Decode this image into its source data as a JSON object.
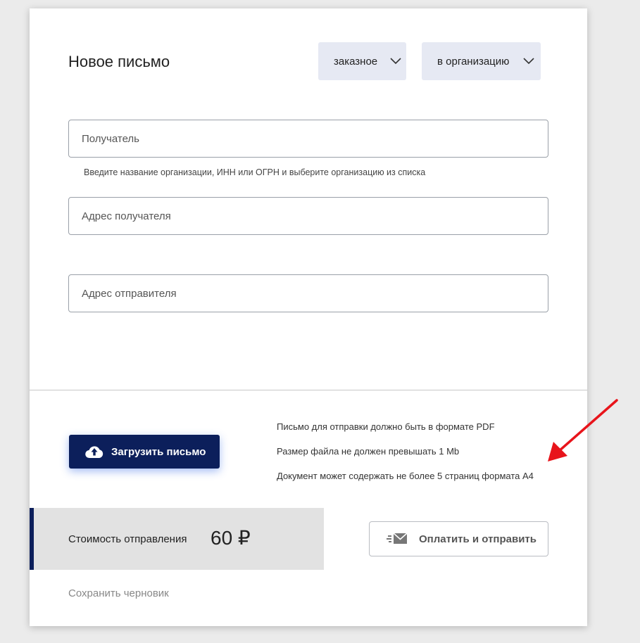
{
  "header": {
    "title": "Новое письмо",
    "type_dropdown": "заказное",
    "recipient_type_dropdown": "в организацию"
  },
  "form": {
    "recipient_placeholder": "Получатель",
    "recipient_hint": "Введите название организации, ИНН или ОГРН и выберите организацию из списка",
    "recipient_address_placeholder": "Адрес получателя",
    "sender_address_placeholder": "Адрес отправителя"
  },
  "upload": {
    "button_label": "Загрузить письмо",
    "requirements": [
      "Письмо для отправки должно быть в формате PDF",
      "Размер файла не должен превышать 1 Mb",
      "Документ может содержать не более 5 страниц формата А4"
    ]
  },
  "footer": {
    "cost_label": "Стоимость отправления",
    "cost_value": "60 ₽",
    "pay_button_label": "Оплатить и отправить",
    "save_draft_label": "Сохранить черновик"
  },
  "colors": {
    "accent": "#0c1f5b",
    "annotation_arrow": "#e8141b"
  },
  "icons": [
    "chevron-down-icon",
    "cloud-upload-icon",
    "envelope-send-icon"
  ]
}
